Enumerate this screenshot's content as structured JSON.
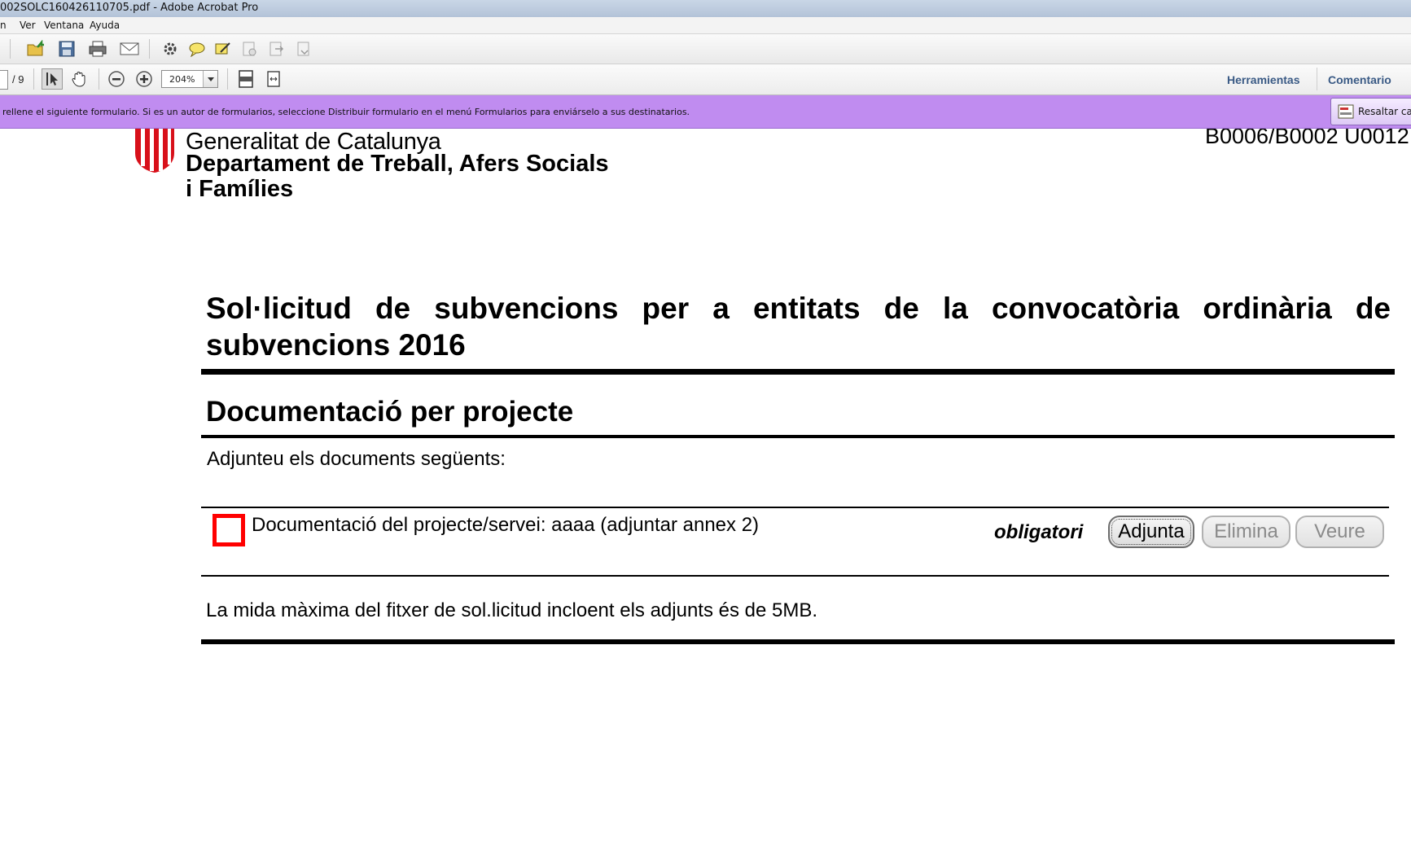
{
  "window": {
    "title": "002SOLC160426110705.pdf - Adobe Acrobat Pro"
  },
  "menu": {
    "items": [
      "n",
      "Ver",
      "Ventana",
      "Ayuda"
    ]
  },
  "toolbar": {
    "icons": [
      "open-folder-icon",
      "save-icon",
      "print-icon",
      "email-icon",
      "settings-icon",
      "comment-icon",
      "sign-icon",
      "form-icon",
      "export-icon",
      "share-icon"
    ]
  },
  "navigation": {
    "page_total": "/ 9",
    "zoom_value": "204%"
  },
  "panes": {
    "tools_label": "Herramientas",
    "comment_label": "Comentario"
  },
  "infobar": {
    "message": "rellene el siguiente formulario. Si es un autor de formularios, seleccione Distribuir formulario en el menú Formularios para enviárselo a sus destinatarios.",
    "highlight_button": "Resaltar cam",
    "color": "#c08cf0"
  },
  "document": {
    "org_name": "Generalitat de Catalunya",
    "department_line1": "Departament de Treball, Afers Socials",
    "department_line2": "i Famílies",
    "doc_code": "B0006/B0002 U0012",
    "title": "Sol·licitud de subvencions per a entitats de la convocatòria ordinària de subvencions 2016",
    "section_title": "Documentació per projecte",
    "intro": "Adjunteu els documents següents:",
    "attachment": {
      "label": "Documentació del projecte/servei: aaaa  (adjuntar annex 2)",
      "required": "obligatori",
      "attach_button": "Adjunta",
      "delete_button": "Elimina",
      "view_button": "Veure"
    },
    "size_note": "La mida màxima del fitxer de sol.licitud incloent els adjunts és de 5MB."
  },
  "colors": {
    "required_marker": "#ff0000",
    "link_text": "#3a5a85"
  }
}
